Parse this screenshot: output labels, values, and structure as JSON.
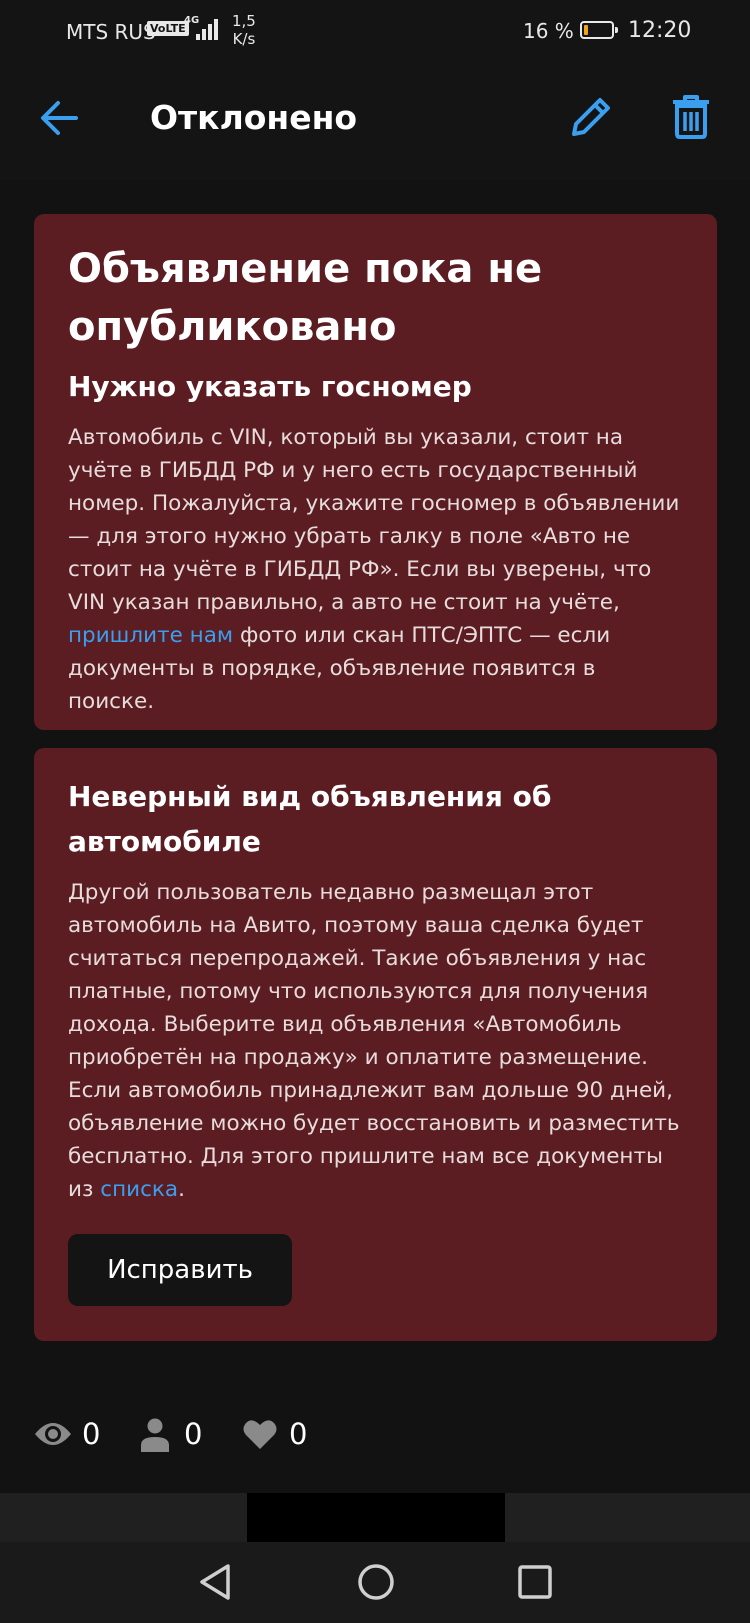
{
  "status_bar": {
    "carrier": "MTS RUS",
    "volte": "VoLTE",
    "network": "4G",
    "speed_value": "1,5",
    "speed_unit": "K/s",
    "battery_percent": "16 %",
    "battery_level": 0.16,
    "time": "12:20"
  },
  "header": {
    "title": "Отклонено"
  },
  "card1": {
    "title": "Объявление пока не опубликовано",
    "subtitle": "Нужно указать госномер",
    "body_before_link": "Автомобиль с VIN, который вы указали, стоит на учёте в ГИБДД РФ и у него есть государственный номер. Пожалуйста, укажите госномер в объявлении — для этого нужно убрать галку в поле «Авто не стоит на учёте в ГИБДД РФ». Если вы уверены, что VIN указан правильно, а авто не стоит на учёте, ",
    "link": "пришлите нам",
    "body_after_link": " фото или скан ПТС/ЭПТС — если документы в порядке, объявление появится в поиске."
  },
  "card2": {
    "title": "Неверный вид объявления об автомобиле",
    "body_before_link": "Другой пользователь недавно размещал этот автомобиль на Авито, поэтому ваша сделка будет считаться перепродажей. Такие объявления у нас платные, потому что используются для получения дохода. Выберите вид объявления «Автомобиль приобретён на продажу» и оплатите размещение. Если автомобиль принадлежит вам дольше 90 дней, объявление можно будет восстановить и разместить бесплатно. Для этого пришлите нам все документы из ",
    "link": "списка",
    "body_after_link": ".",
    "button": "Исправить"
  },
  "stats": {
    "views": "0",
    "contacts": "0",
    "favorites": "0"
  },
  "colors": {
    "accent": "#3b9ff0",
    "card_bg": "#5b1c22",
    "page_bg": "#121212"
  }
}
